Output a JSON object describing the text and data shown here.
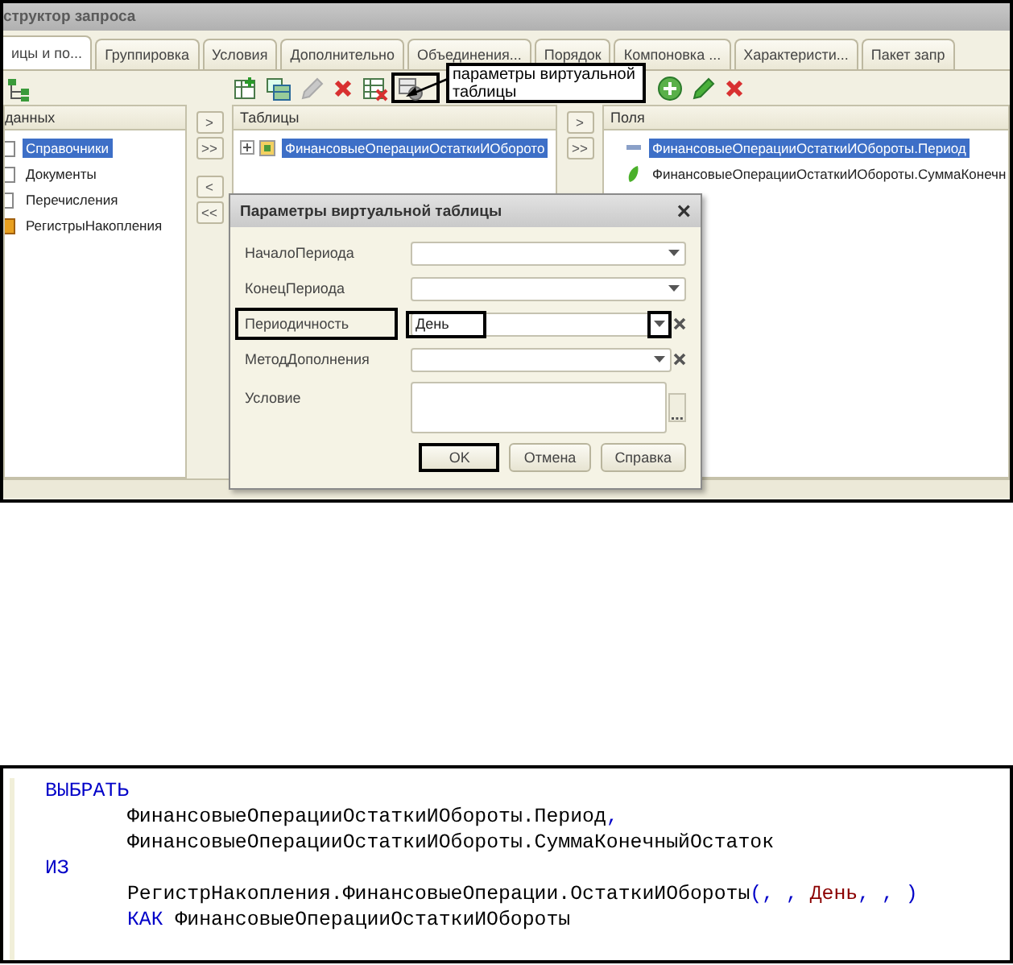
{
  "query_designer": {
    "title": "структор запроса",
    "tabs": [
      {
        "label": "ицы и по...",
        "selected": true
      },
      {
        "label": "Группировка",
        "selected": false
      },
      {
        "label": "Условия",
        "selected": false
      },
      {
        "label": "Дополнительно",
        "selected": false
      },
      {
        "label": "Объединения...",
        "selected": false
      },
      {
        "label": "Порядок",
        "selected": false
      },
      {
        "label": "Компоновка ...",
        "selected": false
      },
      {
        "label": "Характеристи...",
        "selected": false
      },
      {
        "label": "Пакет запр",
        "selected": false
      }
    ],
    "sources_toolbar": [
      {
        "kind": "tree",
        "highlighted": false
      }
    ],
    "tables_toolbar": [
      {
        "kind": "add-table",
        "highlighted": false
      },
      {
        "kind": "add-nested",
        "highlighted": false
      },
      {
        "kind": "edit",
        "highlighted": false
      },
      {
        "kind": "delete",
        "highlighted": false
      },
      {
        "kind": "grid",
        "highlighted": false
      },
      {
        "kind": "params",
        "highlighted": true
      }
    ],
    "fields_toolbar": [
      {
        "kind": "add",
        "highlighted": false
      },
      {
        "kind": "edit-green",
        "highlighted": false
      },
      {
        "kind": "delete",
        "highlighted": false
      }
    ],
    "callout": "параметры виртуальной таблицы",
    "sources": {
      "header": "данных",
      "items": [
        {
          "label": "Справочники",
          "selected": true
        },
        {
          "label": "Документы",
          "selected": false
        },
        {
          "label": "Перечисления",
          "selected": false
        },
        {
          "label": "РегистрыНакопления",
          "selected": false
        }
      ]
    },
    "table_buttons": [
      ">",
      ">>",
      "<",
      "<<"
    ],
    "tables": {
      "header": "Таблицы",
      "items": [
        {
          "label": "ФинансовыеОперацииОстаткиИОборото",
          "selected": true
        }
      ]
    },
    "field_buttons": [
      ">",
      ">>"
    ],
    "fields": {
      "header": "Поля",
      "items": [
        {
          "label": "ФинансовыеОперацииОстаткиИОбороты.Период",
          "selected": true,
          "kind": "dimension"
        },
        {
          "label": "ФинансовыеОперацииОстаткиИОбороты.СуммаКонечн",
          "selected": false,
          "kind": "resource"
        }
      ]
    },
    "dialog": {
      "title": "Параметры виртуальной таблицы",
      "close": "×",
      "rows": [
        {
          "label": "НачалоПериода",
          "kind": "select",
          "highlighted": false
        },
        {
          "label": "КонецПериода",
          "kind": "select",
          "highlighted": false
        },
        {
          "label": "Периодичность",
          "kind": "select-clear",
          "value": "День",
          "highlighted": true
        },
        {
          "label": "МетодДополнения",
          "kind": "select-clear",
          "highlighted": false
        },
        {
          "label": "Условие",
          "kind": "textarea",
          "highlighted": false
        }
      ],
      "buttons": [
        {
          "label": "OK",
          "highlighted": true
        },
        {
          "label": "Отмена",
          "highlighted": false
        },
        {
          "label": "Справка",
          "highlighted": false
        }
      ]
    }
  },
  "query_text": {
    "blocks": [
      {
        "tokens": [
          {
            "kind": "keyword",
            "text": "ВЫБРАТЬ"
          }
        ],
        "children": [
          {
            "tokens": [
              {
                "kind": "name",
                "text": "ФинансовыеОперацииОстаткиИОбороты.Период"
              },
              {
                "kind": "punct",
                "text": ","
              }
            ]
          },
          {
            "tokens": [
              {
                "kind": "name",
                "text": "ФинансовыеОперацииОстаткиИОбороты.СуммаКонечныйОстаток"
              }
            ]
          }
        ]
      },
      {
        "tokens": [
          {
            "kind": "keyword",
            "text": "ИЗ"
          }
        ],
        "children": [
          {
            "tokens": [
              {
                "kind": "name",
                "text": "РегистрНакопления.ФинансовыеОперации.ОстаткиИОбороты"
              },
              {
                "kind": "punct",
                "text": "(, , "
              },
              {
                "kind": "literal",
                "text": "День"
              },
              {
                "kind": "punct",
                "text": ", , )"
              }
            ]
          },
          {
            "tokens": [
              {
                "kind": "keyword",
                "text": "КАК"
              },
              {
                "kind": "name",
                "text": "ФинансовыеОперацииОстаткиИОбороты"
              }
            ]
          }
        ]
      }
    ]
  }
}
